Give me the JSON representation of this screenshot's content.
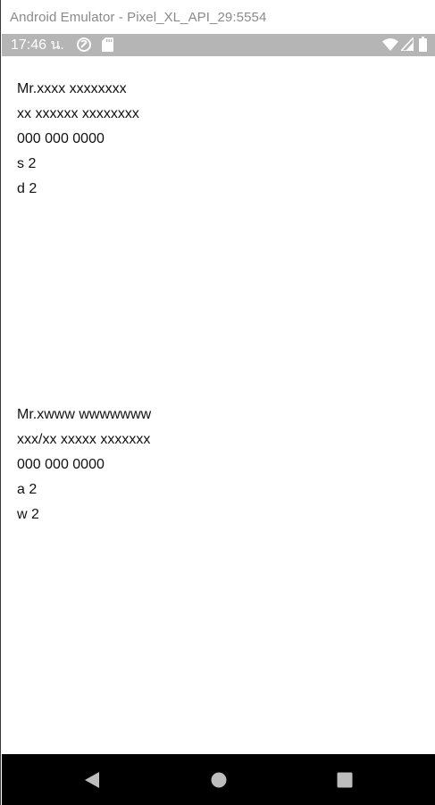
{
  "window": {
    "title": "Android Emulator - Pixel_XL_API_29:5554"
  },
  "status_bar": {
    "time": "17:46 น.",
    "icons": [
      "sync-disabled-icon",
      "sd-card-icon",
      "wifi-icon",
      "cellular-signal-icon",
      "battery-icon"
    ]
  },
  "cards": [
    {
      "lines": [
        "Mr.xxxx xxxxxxxx",
        "xx xxxxxx xxxxxxxx",
        "000 000 0000",
        "s 2",
        "d 2"
      ]
    },
    {
      "lines": [
        "Mr.xwww wwwwwww",
        "xxx/xx xxxxx xxxxxxx",
        "000 000 0000",
        "a 2",
        "w 2"
      ]
    }
  ],
  "nav_bar": {
    "buttons": [
      "back-icon",
      "home-icon",
      "recents-icon"
    ]
  }
}
